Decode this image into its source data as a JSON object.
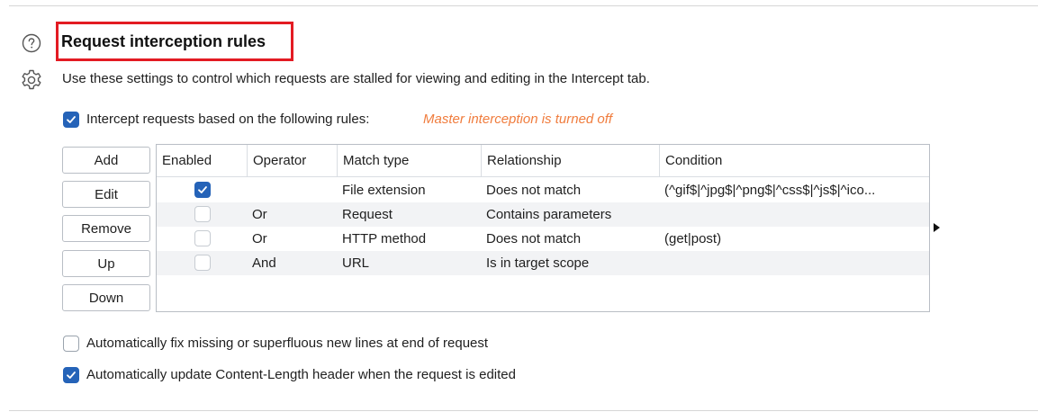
{
  "section": {
    "title": "Request interception rules",
    "description": "Use these settings to control which requests are stalled for viewing and editing in the Intercept tab."
  },
  "intercept": {
    "checked": true,
    "label": "Intercept requests based on the following rules:",
    "status": "Master interception is turned off"
  },
  "buttons": {
    "add": "Add",
    "edit": "Edit",
    "remove": "Remove",
    "up": "Up",
    "down": "Down"
  },
  "table": {
    "columns": [
      "Enabled",
      "Operator",
      "Match type",
      "Relationship",
      "Condition"
    ],
    "rows": [
      {
        "enabled": true,
        "operator": "",
        "match_type": "File extension",
        "relationship": "Does not match",
        "condition": "(^gif$|^jpg$|^png$|^css$|^js$|^ico..."
      },
      {
        "enabled": false,
        "operator": "Or",
        "match_type": "Request",
        "relationship": "Contains parameters",
        "condition": ""
      },
      {
        "enabled": false,
        "operator": "Or",
        "match_type": "HTTP method",
        "relationship": "Does not match",
        "condition": "(get|post)"
      },
      {
        "enabled": false,
        "operator": "And",
        "match_type": "URL",
        "relationship": "Is in target scope",
        "condition": ""
      }
    ]
  },
  "options": {
    "fix_newlines": {
      "checked": false,
      "label": "Automatically fix missing or superfluous new lines at end of request"
    },
    "update_content_length": {
      "checked": true,
      "label": "Automatically update Content-Length header when the request is edited"
    }
  },
  "colors": {
    "accent": "#2563b8",
    "highlight_box": "#e31b23",
    "warning": "#f07c3d"
  }
}
